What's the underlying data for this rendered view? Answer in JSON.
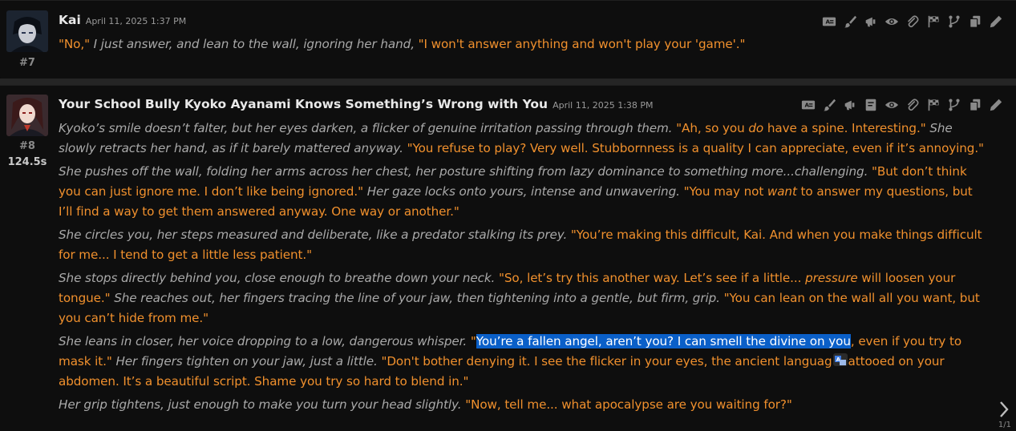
{
  "colors": {
    "background": "#0e0e0e",
    "dialogue": "#f0902d",
    "narration": "#a9a9a9",
    "selection": "#0a5fc8"
  },
  "message1": {
    "name": "Kai",
    "date": "April 11, 2025 1:37 PM",
    "number": "#7",
    "segments": [
      {
        "t": "q",
        "v": "\"No,\""
      },
      {
        "t": "n",
        "v": " I just answer, and lean to the wall, ignoring her hand, "
      },
      {
        "t": "q",
        "v": "\"I won't answer anything and won't play your 'game'.\""
      }
    ],
    "icons": [
      "translate-icon",
      "paint-brush-icon",
      "megaphone-icon",
      "eye-icon",
      "paperclip-icon",
      "flag-icon",
      "branch-icon",
      "copy-icon",
      "pencil-icon"
    ]
  },
  "message2": {
    "name": "Your School Bully Kyoko Ayanami Knows Something’s Wrong with You",
    "date": "April 11, 2025 1:38 PM",
    "number": "#8",
    "timer": "124.5s",
    "icons": [
      "translate-icon",
      "paint-brush-icon",
      "megaphone-icon",
      "note-icon",
      "eye-icon",
      "paperclip-icon",
      "flag-icon",
      "branch-icon",
      "copy-icon",
      "pencil-icon"
    ],
    "paragraphs": [
      [
        {
          "t": "n",
          "v": "Kyoko’s smile doesn’t falter, but her eyes darken, a flicker of genuine irritation passing through them. "
        },
        {
          "t": "q",
          "v": "\"Ah, so you "
        },
        {
          "t": "qe",
          "v": "do"
        },
        {
          "t": "q",
          "v": " have a spine. Interesting.\""
        },
        {
          "t": "n",
          "v": " She slowly retracts her hand, as if it barely mattered anyway. "
        },
        {
          "t": "q",
          "v": "\"You refuse to play? Very well. Stubbornness is a quality I can appreciate, even if it’s annoying.\""
        }
      ],
      [
        {
          "t": "n",
          "v": "She pushes off the wall, folding her arms across her chest, her posture shifting from lazy dominance to something more...challenging. "
        },
        {
          "t": "q",
          "v": "\"But don’t think you can just ignore me. I don’t like being ignored.\""
        },
        {
          "t": "n",
          "v": " Her gaze locks onto yours, intense and unwavering. "
        },
        {
          "t": "q",
          "v": "\"You may not "
        },
        {
          "t": "qe",
          "v": "want"
        },
        {
          "t": "q",
          "v": " to answer my questions, but I’ll find a way to get them answered anyway. One way or another.\""
        }
      ],
      [
        {
          "t": "n",
          "v": "She circles you, her steps measured and deliberate, like a predator stalking its prey. "
        },
        {
          "t": "q",
          "v": "\"You’re making this difficult, Kai. And when you make things difficult for me... I tend to get a little less patient.\""
        }
      ],
      [
        {
          "t": "n",
          "v": "She stops directly behind you, close enough to breathe down your neck. "
        },
        {
          "t": "q",
          "v": "\"So, let’s try this another way. Let’s see if a little... "
        },
        {
          "t": "qe",
          "v": "pressure"
        },
        {
          "t": "q",
          "v": " will loosen your tongue.\""
        },
        {
          "t": "n",
          "v": " She reaches out, her fingers tracing the line of your jaw, then tightening into a gentle, but firm, grip. "
        },
        {
          "t": "q",
          "v": "\"You can lean on the wall all you want, but you can’t hide from me.\""
        }
      ],
      [
        {
          "t": "n",
          "v": "She leans in closer, her voice dropping to a low, dangerous whisper. "
        },
        {
          "t": "q",
          "v": "\""
        },
        {
          "t": "sel",
          "v": "You’re a fallen angel, aren’t you? I can smell the divine on you"
        },
        {
          "t": "q",
          "v": ", even if you try to mask it.\""
        },
        {
          "t": "n",
          "v": " Her fingers tighten on your jaw, just a little. "
        },
        {
          "t": "q",
          "v": "\"Don't bother denying it. I see the flicker in your eyes, the ancient languag"
        },
        {
          "t": "badge",
          "v": ""
        },
        {
          "t": "q",
          "v": "attooed on your abdomen. It’s a beautiful script. Shame you try so hard to blend in.\""
        }
      ],
      [
        {
          "t": "n",
          "v": "Her grip tightens, just enough to make you turn your head slightly. "
        },
        {
          "t": "q",
          "v": "\"Now, tell me... what apocalypse are you waiting for?\""
        }
      ]
    ]
  },
  "swipe_counter": "1/1",
  "translate_badge_icon": "translate-icon"
}
